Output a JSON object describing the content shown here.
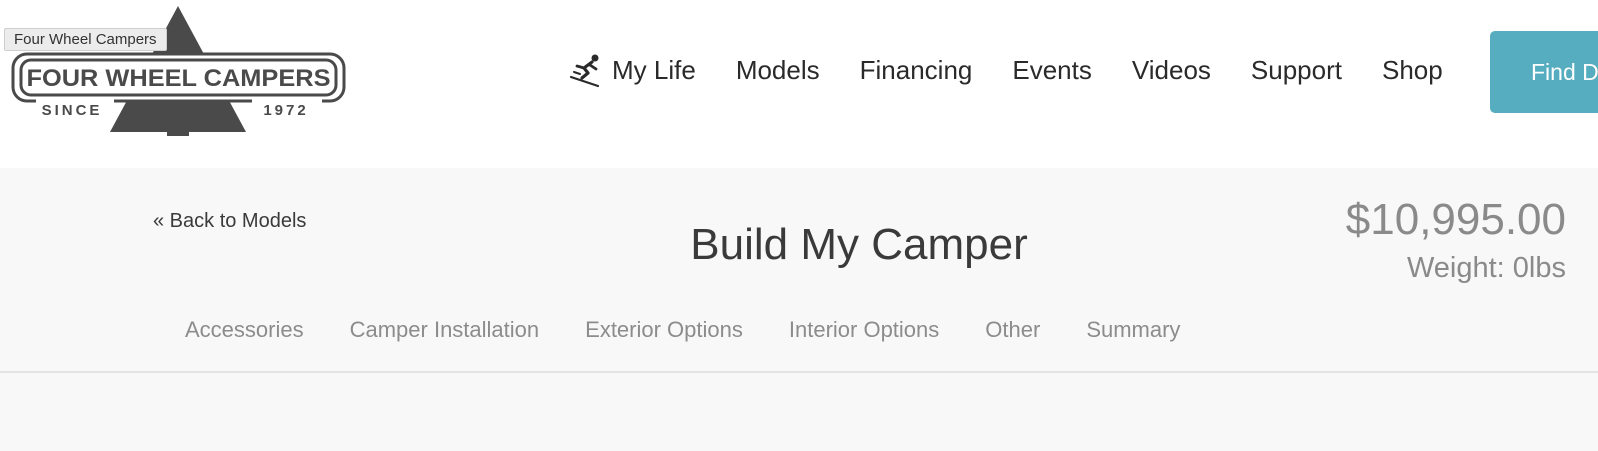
{
  "header": {
    "logo": {
      "tooltip": "Four Wheel Campers",
      "wordmark": "FOUR WHEEL CAMPERS",
      "since_label": "SINCE",
      "year": "1972"
    },
    "nav": {
      "items": [
        {
          "label": "My Life",
          "icon": "skier-icon"
        },
        {
          "label": "Models"
        },
        {
          "label": "Financing"
        },
        {
          "label": "Events"
        },
        {
          "label": "Videos"
        },
        {
          "label": "Support"
        },
        {
          "label": "Shop"
        }
      ]
    },
    "cta": {
      "label": "Find D"
    }
  },
  "builder": {
    "back_link": "« Back to Models",
    "title": "Build My Camper",
    "price": "$10,995.00",
    "weight": "Weight: 0lbs",
    "tabs": [
      {
        "label": "Accessories"
      },
      {
        "label": "Camper Installation"
      },
      {
        "label": "Exterior Options"
      },
      {
        "label": "Interior Options"
      },
      {
        "label": "Other"
      },
      {
        "label": "Summary"
      }
    ]
  },
  "colors": {
    "accent": "#55adbf",
    "logo": "#4a4a4a",
    "background_band": "#f8f8f8",
    "muted_text": "#8a8a8a"
  }
}
